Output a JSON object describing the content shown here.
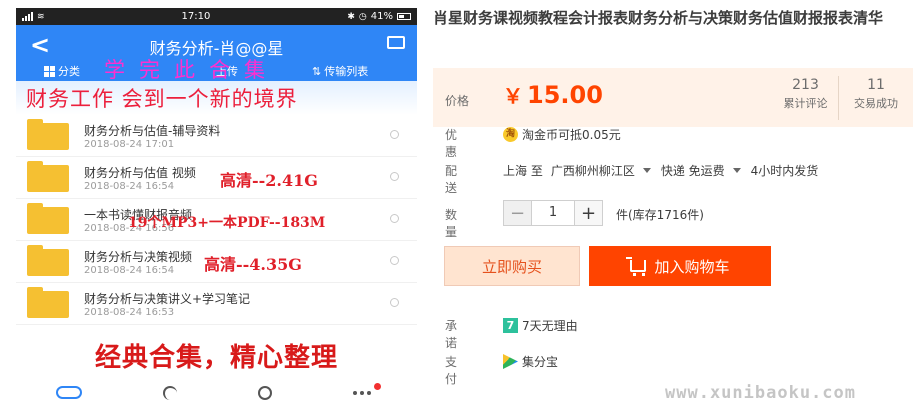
{
  "phone": {
    "status": {
      "time": "17:10",
      "battery": "41%"
    },
    "app_bar": {
      "title": "财务分析-肖@@星",
      "back_glyph": "<"
    },
    "toolbar": {
      "category": "分类",
      "upload": "上传",
      "transfer": "传输列表"
    },
    "overlay_xue": "学完此合集",
    "banner_top": "财务工作 会到一个新的境界",
    "files": [
      {
        "name": "财务分析与估值-辅导资料",
        "date": "2018-08-24 17:01"
      },
      {
        "name": "财务分析与估值 视频",
        "date": "2018-08-24 16:54"
      },
      {
        "name": "一本书读懂财报音频",
        "date": "2018-08-24 16:56"
      },
      {
        "name": "财务分析与决策视频",
        "date": "2018-08-24 16:54"
      },
      {
        "name": "财务分析与决策讲义+学习笔记",
        "date": "2018-08-24 16:53"
      }
    ],
    "overlays": {
      "hd1": "高清--2.41G",
      "mp3": "19个MP3+一本PDF--183M",
      "hd2": "高清--4.35G"
    },
    "banner_bottom": "经典合集，精心整理",
    "tabs": [
      "cloud-icon",
      "share-icon",
      "clock-icon",
      "more-icon"
    ]
  },
  "product": {
    "title": "肖星财务课视频教程会计报表财务分析与决策财务估值财报报表清华",
    "price": {
      "label": "价格",
      "currency": "￥",
      "amount": "15.00"
    },
    "stats": [
      {
        "value": "213",
        "caption": "累计评论"
      },
      {
        "value": "11",
        "caption": "交易成功"
      }
    ],
    "promo": {
      "label": "优惠",
      "coin_glyph": "淘",
      "text": "淘金币可抵0.05元"
    },
    "shipping": {
      "label": "配送",
      "from": "上海 至",
      "to": "广西柳州柳江区",
      "method": "快递 免运费",
      "time": "4小时内发货"
    },
    "quantity": {
      "label": "数量",
      "minus": "−",
      "value": "1",
      "plus": "+",
      "stock": "件(库存1716件)"
    },
    "buttons": {
      "buy": "立即购买",
      "cart": "加入购物车"
    },
    "promise": {
      "label": "承诺",
      "badge": "7",
      "text": "7天无理由"
    },
    "payment": {
      "label": "支付",
      "text": "集分宝"
    }
  },
  "watermark": "www.xunibaoku.com",
  "colors": {
    "accent": "#ff4400",
    "price": "#ff4400",
    "app_blue": "#2f86f6",
    "folder": "#f5c032"
  }
}
